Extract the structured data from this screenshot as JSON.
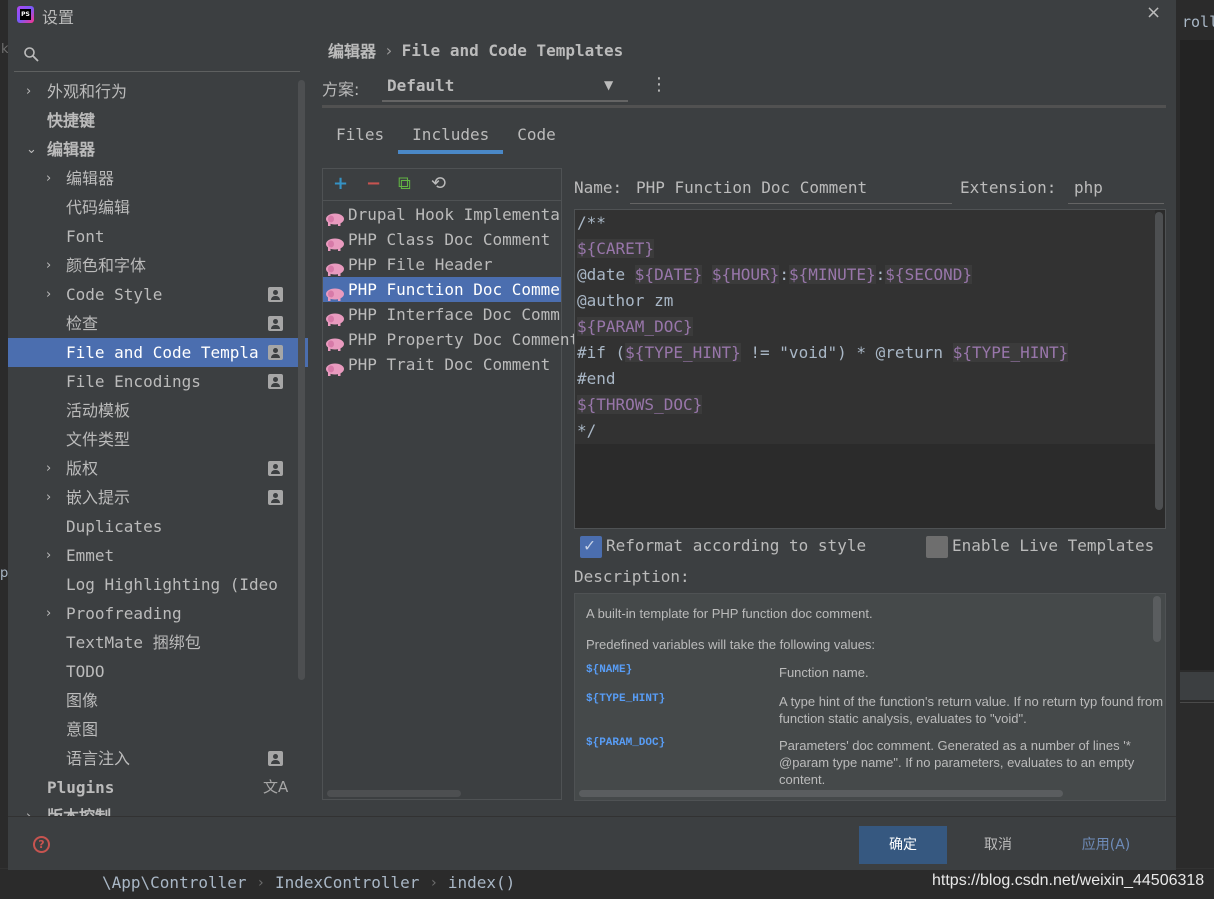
{
  "background": {
    "edge_text": "roll",
    "left_chars": [
      "k",
      "p"
    ],
    "breadcrumbs": [
      "\\App\\Controller",
      "IndexController",
      "index()"
    ],
    "watermark": "https://blog.csdn.net/weixin_44506318"
  },
  "dialog": {
    "title": "设置",
    "close_label": "×"
  },
  "search": {
    "icon": "search-icon",
    "value": ""
  },
  "tree": [
    {
      "label": "外观和行为",
      "arrow": "›",
      "bold": false
    },
    {
      "label": "快捷键",
      "arrow": "",
      "bold": true
    },
    {
      "label": "编辑器",
      "arrow": "⌄",
      "bold": true
    },
    {
      "label": "编辑器",
      "arrow": "›",
      "bold": false
    },
    {
      "label": "代码编辑",
      "arrow": "",
      "bold": false
    },
    {
      "label": "Font",
      "arrow": "",
      "bold": false
    },
    {
      "label": "颜色和字体",
      "arrow": "›",
      "bold": false
    },
    {
      "label": "Code Style",
      "arrow": "›",
      "bold": false
    },
    {
      "label": "检查",
      "arrow": "",
      "bold": false
    },
    {
      "label": "File and Code Templa",
      "arrow": "",
      "bold": false
    },
    {
      "label": "File Encodings",
      "arrow": "",
      "bold": false
    },
    {
      "label": "活动模板",
      "arrow": "",
      "bold": false
    },
    {
      "label": "文件类型",
      "arrow": "",
      "bold": false
    },
    {
      "label": "版权",
      "arrow": "›",
      "bold": false
    },
    {
      "label": "嵌入提示",
      "arrow": "›",
      "bold": false
    },
    {
      "label": "Duplicates",
      "arrow": "",
      "bold": false
    },
    {
      "label": "Emmet",
      "arrow": "›",
      "bold": false
    },
    {
      "label": "Log Highlighting (Ideo",
      "arrow": "",
      "bold": false
    },
    {
      "label": "Proofreading",
      "arrow": "›",
      "bold": false
    },
    {
      "label": "TextMate 捆绑包",
      "arrow": "",
      "bold": false
    },
    {
      "label": "TODO",
      "arrow": "",
      "bold": false
    },
    {
      "label": "图像",
      "arrow": "",
      "bold": false
    },
    {
      "label": "意图",
      "arrow": "",
      "bold": false
    },
    {
      "label": "语言注入",
      "arrow": "",
      "bold": false
    },
    {
      "label": "Plugins",
      "arrow": "",
      "bold": true
    },
    {
      "label": "版本控制",
      "arrow": "›",
      "bold": true
    }
  ],
  "translate_glyph": "文A",
  "breadcrumb": {
    "parent": "编辑器",
    "separator": "›",
    "current": "File and Code Templates"
  },
  "scheme": {
    "label": "方案:",
    "value": "Default",
    "chevron": "▼",
    "menu": "⋮"
  },
  "tabs": [
    "Files",
    "Includes",
    "Code"
  ],
  "toolbar": {
    "add": "+",
    "remove": "−",
    "copy": "⧉",
    "reset": "⟲"
  },
  "templates": [
    "Drupal Hook Implementa",
    "PHP Class Doc Comment",
    "PHP File Header",
    "PHP Function Doc Comme",
    "PHP Interface Doc Comm",
    "PHP Property Doc Comment",
    "PHP Trait Doc Comment"
  ],
  "name": {
    "label": "Name:",
    "value": "PHP Function Doc Comment"
  },
  "extension": {
    "label": "Extension:",
    "value": "php"
  },
  "code": {
    "l1": "/**",
    "l2_var": "${CARET}",
    "l3_prefix": "@date ",
    "l3_date": "${DATE}",
    "l3_hour": "${HOUR}",
    "l3_colon": ":",
    "l3_min": "${MINUTE}",
    "l3_sec": "${SECOND}",
    "l4": "@author zm",
    "l5_var": "${PARAM_DOC}",
    "l6_a": "#if (",
    "l6_var": "${TYPE_HINT}",
    "l6_b": " != \"void\") * @return ",
    "l6_var2": "${TYPE_HINT}",
    "l7": "#end",
    "l8_var": "${THROWS_DOC}",
    "l9": "*/"
  },
  "reformat": {
    "label": "Reformat according to style",
    "checked": true
  },
  "live": {
    "label": "Enable Live Templates",
    "checked": false
  },
  "description": {
    "label": "Description:",
    "intro": "A built-in template for PHP function doc comment.",
    "vars_intro": "Predefined variables will take the following values:",
    "vars": [
      {
        "name": "${NAME}",
        "desc": "Function name."
      },
      {
        "name": "${TYPE_HINT}",
        "desc": "A type hint of the function's return value. If no return typ found from function static analysis, evaluates to \"void\"."
      },
      {
        "name": "${PARAM_DOC}",
        "desc": "Parameters' doc comment. Generated as a number of lines '* @param type name\". If no parameters, evaluates to an empty content."
      }
    ]
  },
  "buttons": {
    "ok": "确定",
    "cancel": "取消",
    "apply": "应用(A)"
  },
  "help": "?"
}
